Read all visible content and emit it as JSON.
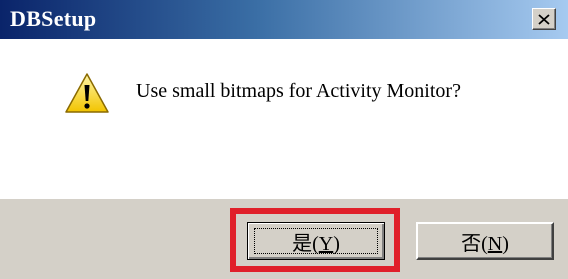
{
  "window": {
    "title": "DBSetup",
    "close_icon": "close-icon"
  },
  "message": {
    "text": "Use small bitmaps for Activity Monitor?",
    "icon": "warning-icon"
  },
  "buttons": {
    "yes": {
      "prefix": "是(",
      "mnemonic": "Y",
      "suffix": ")"
    },
    "no": {
      "prefix": "否(",
      "mnemonic": "N",
      "suffix": ")"
    }
  },
  "colors": {
    "highlight": "#e0202a",
    "title_bar_start": "#0a246a",
    "title_bar_end": "#a6caf0",
    "dialog_face": "#d4d0c8"
  }
}
